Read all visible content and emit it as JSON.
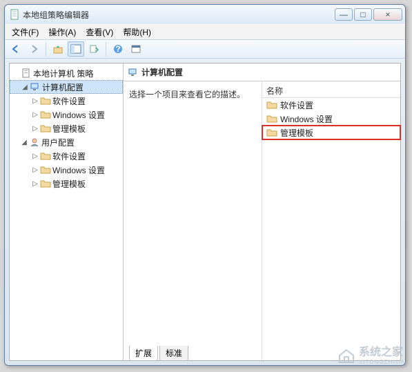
{
  "window": {
    "title": "本地组策略编辑器",
    "buttons": {
      "minimize": "—",
      "maximize": "□",
      "close": "×"
    }
  },
  "menu": {
    "file": "文件(F)",
    "action": "操作(A)",
    "view": "查看(V)",
    "help": "帮助(H)"
  },
  "tree": {
    "root": "本地计算机 策略",
    "computer_config": "计算机配置",
    "cc_software": "软件设置",
    "cc_windows": "Windows 设置",
    "cc_admin": "管理模板",
    "user_config": "用户配置",
    "uc_software": "软件设置",
    "uc_windows": "Windows 设置",
    "uc_admin": "管理模板"
  },
  "heading": "计算机配置",
  "description": "选择一个项目来查看它的描述。",
  "list": {
    "header": "名称",
    "items": [
      {
        "label": "软件设置"
      },
      {
        "label": "Windows 设置"
      },
      {
        "label": "管理模板"
      }
    ]
  },
  "tabs": {
    "extended": "扩展",
    "standard": "标准"
  },
  "watermark": {
    "text": "系统之家",
    "sub": "XITONGZHIJIA"
  }
}
